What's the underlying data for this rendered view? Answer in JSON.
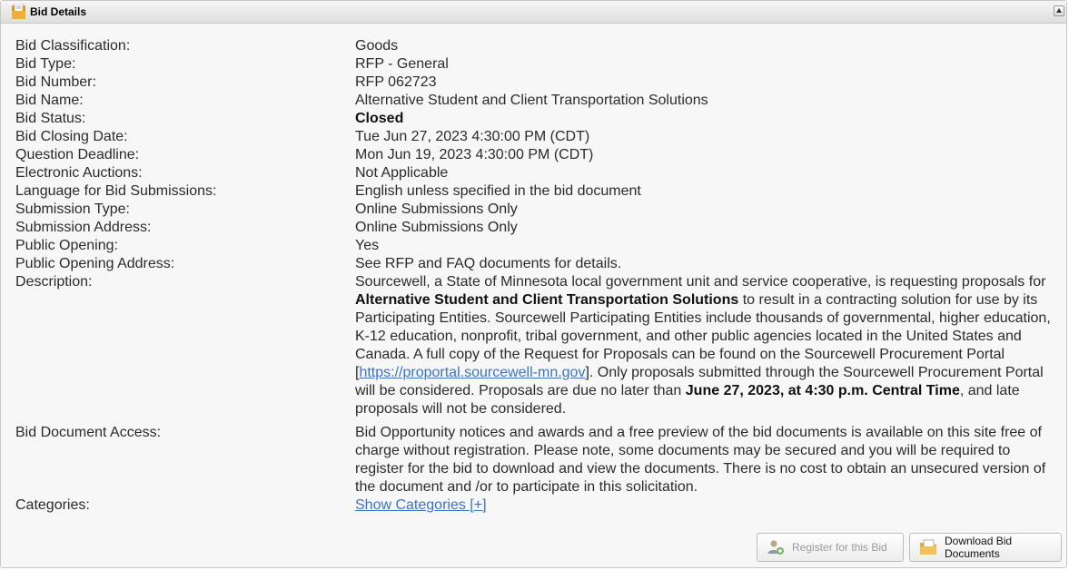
{
  "panel": {
    "title": "Bid Details",
    "icons": {
      "header": "folder-document-icon",
      "collapse": "collapse-up-icon"
    }
  },
  "details": [
    {
      "label": "Bid Classification:",
      "value": "Goods"
    },
    {
      "label": "Bid Type:",
      "value": "RFP - General"
    },
    {
      "label": "Bid Number:",
      "value": "RFP 062723"
    },
    {
      "label": "Bid Name:",
      "value": "Alternative Student and Client Transportation Solutions"
    },
    {
      "label": "Bid Status:",
      "value": "Closed"
    },
    {
      "label": "Bid Closing Date:",
      "value": "Tue Jun 27, 2023 4:30:00 PM (CDT)"
    },
    {
      "label": "Question Deadline:",
      "value": "Mon Jun 19, 2023 4:30:00 PM (CDT)"
    },
    {
      "label": "Electronic Auctions:",
      "value": "Not Applicable"
    },
    {
      "label": "Language for Bid Submissions:",
      "value": "English unless specified in the bid document"
    },
    {
      "label": "Submission Type:",
      "value": "Online Submissions Only"
    },
    {
      "label": "Submission Address:",
      "value": "Online Submissions Only"
    },
    {
      "label": "Public Opening:",
      "value": "Yes"
    },
    {
      "label": "Public Opening Address:",
      "value": "See RFP and FAQ documents for details."
    }
  ],
  "description": {
    "label": "Description:",
    "p1": "Sourcewell, a State of Minnesota local government unit and service cooperative, is requesting proposals for ",
    "bold1": "Alternative Student and Client Transportation Solutions",
    "p2": " to result in a contracting solution for use by its Participating Entities. Sourcewell Participating Entities include thousands of governmental, higher education, K-12 education, nonprofit, tribal government, and other public agencies located in the United States and Canada. A full copy of the Request for Proposals can be found on the Sourcewell Procurement Portal [",
    "link": "https://proportal.sourcewell-mn.gov",
    "p3": "]. Only proposals submitted through the Sourcewell Procurement Portal will be considered. Proposals are due no later than ",
    "bold2": "June 27, 2023, at 4:30 p.m. Central Time",
    "p4": ", and late proposals will not be considered."
  },
  "access": {
    "label": "Bid Document Access:",
    "value": "Bid Opportunity notices and awards and a free preview of the bid documents is available on this site free of charge without registration. Please note, some documents may be secured and you will be required to register for the bid to download and view the documents. There is no cost to obtain an unsecured version of the document and /or to participate in this solicitation."
  },
  "categories": {
    "label": "Categories:",
    "link": "Show Categories [+]"
  },
  "buttons": {
    "register": "Register for this Bid",
    "download": "Download Bid Documents",
    "icons": {
      "register": "user-register-icon",
      "download": "folder-download-icon"
    }
  },
  "colors": {
    "link": "#3a73c9",
    "text": "#2b2b2b",
    "panel_bg": "#f7f7f7"
  }
}
